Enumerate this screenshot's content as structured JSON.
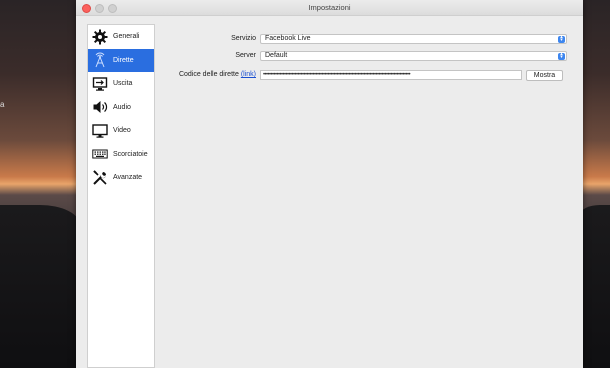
{
  "window": {
    "title": "Impostazioni"
  },
  "sidebar": {
    "items": [
      {
        "label": "Generali",
        "icon": "gear-icon"
      },
      {
        "label": "Dirette",
        "icon": "antenna-icon",
        "active": true
      },
      {
        "label": "Uscita",
        "icon": "output-icon"
      },
      {
        "label": "Audio",
        "icon": "speaker-icon"
      },
      {
        "label": "Video",
        "icon": "monitor-icon"
      },
      {
        "label": "Scorciatoie",
        "icon": "keyboard-icon"
      },
      {
        "label": "Avanzate",
        "icon": "tools-icon"
      }
    ]
  },
  "stream": {
    "service_label": "Servizio",
    "service_value": "Facebook Live",
    "server_label": "Server",
    "server_value": "Default",
    "key_label": "Codice delle dirette",
    "key_link": "(link)",
    "key_value": "••••••••••••••••••••••••••••••••••••••••••••••••••••••••••••••••••••••••••••••••••••••••••••••••••",
    "show_button": "Mostra"
  },
  "colors": {
    "accent": "#2a6ee0",
    "stepper": "#3d86ef",
    "close": "#fc605c"
  }
}
